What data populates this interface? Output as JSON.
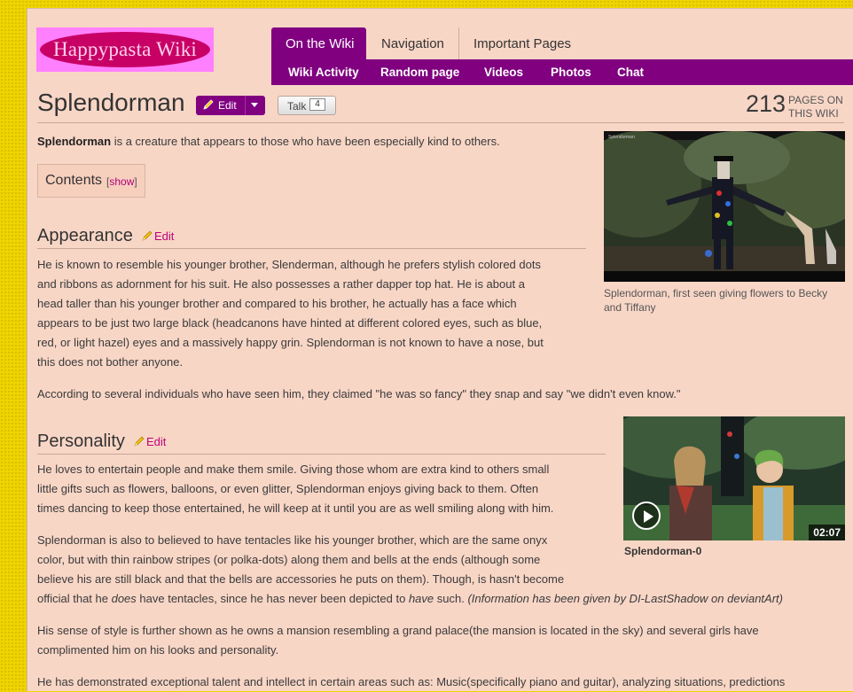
{
  "logo": {
    "text": "Happypasta Wiki"
  },
  "tabs": {
    "on_the_wiki": "On the Wiki",
    "navigation": "Navigation",
    "important_pages": "Important Pages"
  },
  "subnav": {
    "wiki_activity": "Wiki Activity",
    "random_page": "Random page",
    "videos": "Videos",
    "photos": "Photos",
    "chat": "Chat"
  },
  "page": {
    "title": "Splendorman",
    "edit_label": "Edit",
    "talk_label": "Talk",
    "talk_count": "4",
    "page_count": "213",
    "page_count_label_1": "PAGES ON",
    "page_count_label_2": "THIS WIKI"
  },
  "intro": {
    "bold": "Splendorman",
    "rest": " is a creature that appears to those who have been especially kind to others."
  },
  "toc": {
    "title": "Contents",
    "show": "show"
  },
  "appearance": {
    "heading": "Appearance",
    "edit": "Edit",
    "p1": [
      "He is known to resemble his younger brother, Slenderman, although he prefers stylish colored dots",
      "and ribbons as adornment for his suit. He also possesses a rather dapper top hat. He is about a",
      "head taller than his younger brother and compared to his brother, he actually has a face which",
      "appears to be just two large black (headcanons have hinted at different colored eyes, such as blue,",
      "red, or light hazel) eyes and a massively happy grin. Splendorman is not known to have a nose, but",
      "this does not bother anyone."
    ],
    "p2": "According to several individuals who have seen him, they claimed \"he was so fancy\" they snap and say \"we didn't even know.\""
  },
  "personality": {
    "heading": "Personality",
    "edit": "Edit",
    "p1": [
      "He loves to entertain people and make them smile. Giving those whom are extra kind to others small",
      "little gifts such as flowers, balloons, or even glitter, Splendorman enjoys giving back to them. Often",
      "times dancing to keep those entertained, he will keep at it until you are as well smiling along with him."
    ],
    "p2": [
      "Splendorman is also to believed to have tentacles like his younger brother, which are the same onyx",
      "color, but with thin rainbow stripes (or polka-dots) along them and bells at the ends (although some",
      "believe his are still black and that the bells are accessories he puts on them). Though, is hasn't become"
    ],
    "p2_last_a": "official that he ",
    "p2_last_does": "does",
    "p2_last_b": " have tentacles, since he has never been depicted to ",
    "p2_last_have": "have",
    "p2_last_c": " such. ",
    "p2_last_info": "(Information has been given by DI-LastShadow on deviantArt)",
    "p3": [
      "His sense of style is further shown as he owns a mansion resembling a grand palace(the mansion is located in the sky) and several girls have",
      "complimented him on his looks and personality."
    ],
    "p4_partial": "He has demonstrated exceptional talent and intellect in certain areas such as: Music(specifically piano and guitar), analyzing situations, predictions"
  },
  "thumb1": {
    "caption": "Splendorman, first seen giving flowers to Becky and Tiffany",
    "bar_title": "Splendorman"
  },
  "thumb2": {
    "duration": "02:07",
    "caption": "Splendorman-0"
  },
  "colors": {
    "accent": "#800080",
    "link": "#c0007a",
    "page_bg": "#f8d6c6",
    "outer_bg": "#efd500"
  }
}
